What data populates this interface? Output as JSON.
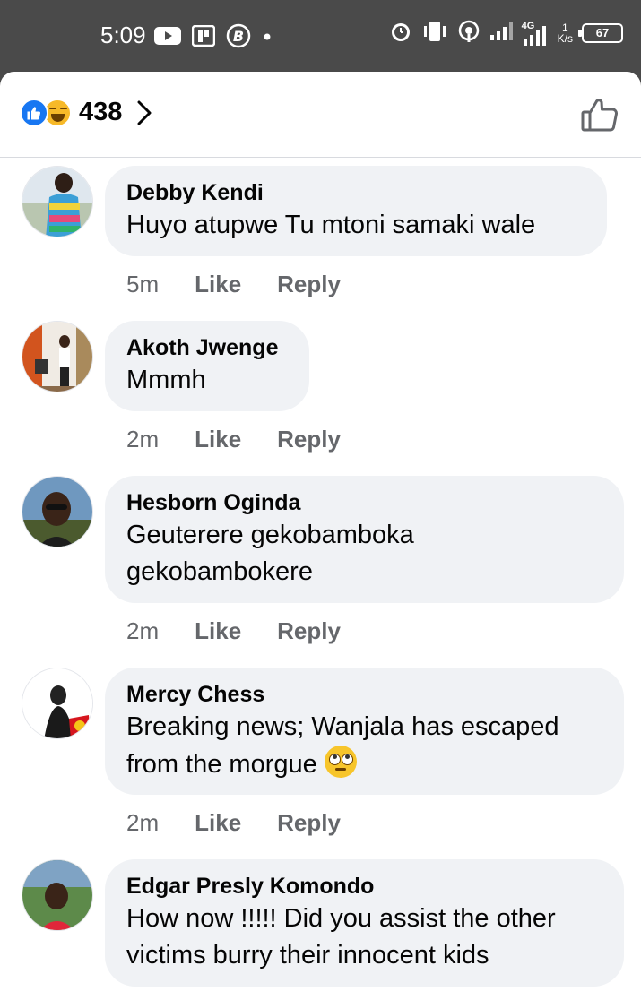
{
  "status_bar": {
    "time": "5:09",
    "left_icons": [
      "youtube-icon",
      "parking-app-icon",
      "bitcoin-icon",
      "notification-dot-icon"
    ],
    "right_icons": [
      "alarm-icon",
      "vibrate-icon",
      "hotspot-icon",
      "signal-icon",
      "signal-4g-icon"
    ],
    "network": "4G",
    "speed_value": "1",
    "speed_unit": "K/s",
    "battery": "67"
  },
  "reactions": {
    "types": [
      "like-icon",
      "haha-icon"
    ],
    "count": "438"
  },
  "comments": [
    {
      "name": "Debby Kendi",
      "lines": [
        "Huyo atupwe Tu mtoni samaki wale"
      ],
      "time": "5m",
      "like_label": "Like",
      "reply_label": "Reply"
    },
    {
      "name": "Akoth Jwenge",
      "lines": [
        "Mmmh"
      ],
      "time": "2m",
      "like_label": "Like",
      "reply_label": "Reply"
    },
    {
      "name": "Hesborn Oginda",
      "lines": [
        "Geuterere gekobamboka",
        "gekobambokere"
      ],
      "time": "2m",
      "like_label": "Like",
      "reply_label": "Reply"
    },
    {
      "name": "Mercy Chess",
      "lines": [
        "Breaking news; Wanjala has escaped",
        "from the morgue"
      ],
      "emoji": "eye-roll-emoji-icon",
      "time": "2m",
      "like_label": "Like",
      "reply_label": "Reply"
    },
    {
      "name": "Edgar Presly Komondo",
      "lines": [
        "How now !!!!! Did you assist the other",
        "victims burry their innocent kids"
      ]
    }
  ],
  "colors": {
    "like_blue": "#1877f2",
    "bubble_bg": "#f0f2f5",
    "meta_gray": "#65676b"
  }
}
